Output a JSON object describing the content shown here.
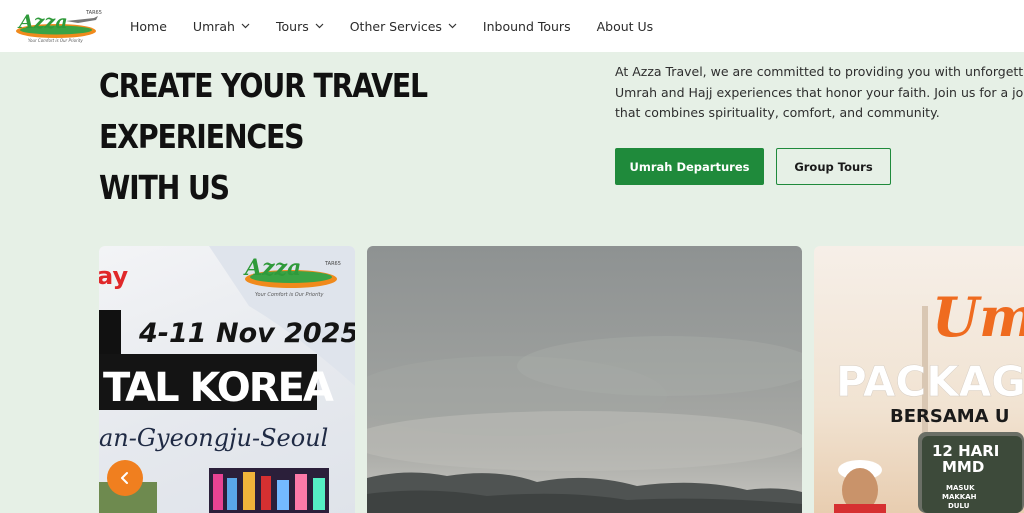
{
  "brand": {
    "logo_text": "Azza",
    "logo_badge": "TAR65",
    "tagline": "Your Comfort is Our Priority"
  },
  "nav": {
    "items": [
      {
        "label": "Home",
        "dropdown": false
      },
      {
        "label": "Umrah",
        "dropdown": true
      },
      {
        "label": "Tours",
        "dropdown": true
      },
      {
        "label": "Other Services",
        "dropdown": true
      },
      {
        "label": "Inbound Tours",
        "dropdown": false
      },
      {
        "label": "About Us",
        "dropdown": false
      }
    ]
  },
  "hero": {
    "title_line1": "CREATE YOUR TRAVEL EXPERIENCES",
    "title_line2": "WITH US",
    "text_line1": "At Azza Travel, we are committed to providing you with unforgett",
    "text_line2": "Umrah and Hajj experiences that honor your faith. Join us for a jo",
    "text_line3": "that combines spirituality, comfort, and community.",
    "primary_button": "Umrah Departures",
    "secondary_button": "Group Tours"
  },
  "carousel": {
    "card1": {
      "corner_text": "ay",
      "logo_text": "Azza",
      "logo_badge": "TAR65",
      "tagline": "Your Comfort is Our Priority",
      "dates": "4-11 Nov 2025",
      "headline": "TAL KOREA",
      "route": "an-Gyeongju-Seoul"
    },
    "card3": {
      "script_text": "Um",
      "headline": "PACKAG",
      "subheadline": "BERSAMA U",
      "badge_days": "12 HARI",
      "badge_code": "MMD",
      "badge_sub1": "MASUK",
      "badge_sub2": "MAKKAH",
      "badge_sub3": "DULU"
    },
    "prev_icon": "chevron-left-icon"
  },
  "colors": {
    "page_bg": "#e6f0e6",
    "accent_green": "#1f8a3b",
    "arrow_orange": "#f07f1f",
    "logo_green": "#2f9a3a",
    "logo_orange": "#f08a1c"
  }
}
